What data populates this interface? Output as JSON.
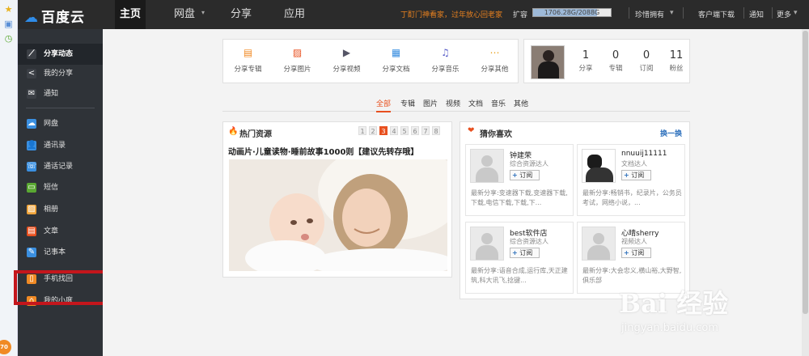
{
  "app": {
    "logo_text": "百度云"
  },
  "top_nav": {
    "tabs": [
      "主页",
      "网盘",
      "分享",
      "应用"
    ],
    "announcement": "丁酊门神看家，过年放心回老家",
    "quota_label": "扩容",
    "quota_text": "1706.28G/2088G",
    "quota_fraction": 0.82,
    "username": "珍惜拥有",
    "links": [
      "客户端下载",
      "通知",
      "更多"
    ]
  },
  "sidebar": {
    "items": [
      {
        "label": "分享动态",
        "icon": "activity-icon",
        "color": "#3b3f45"
      },
      {
        "label": "我的分享",
        "icon": "share-icon",
        "color": "#3b3f45"
      },
      {
        "label": "通知",
        "icon": "mail-icon",
        "color": "#3b3f45"
      },
      {
        "label": "网盘",
        "icon": "cloud-icon",
        "color": "#3a8fe0"
      },
      {
        "label": "通讯录",
        "icon": "contacts-icon",
        "color": "#3a8fe0"
      },
      {
        "label": "通话记录",
        "icon": "call-log-icon",
        "color": "#3a8fe0"
      },
      {
        "label": "短信",
        "icon": "sms-icon",
        "color": "#5aa832"
      },
      {
        "label": "相册",
        "icon": "album-icon",
        "color": "#f0a43a"
      },
      {
        "label": "文章",
        "icon": "article-icon",
        "color": "#e8501f"
      },
      {
        "label": "记事本",
        "icon": "notepad-icon",
        "color": "#3a8fe0"
      },
      {
        "label": "手机找回",
        "icon": "phone-find-icon",
        "color": "#f08a24"
      },
      {
        "label": "我的小度",
        "icon": "home-icon",
        "color": "#f08a24"
      }
    ]
  },
  "share_panel": {
    "buttons": [
      "分享专辑",
      "分享图片",
      "分享视频",
      "分享文档",
      "分享音乐",
      "分享其他"
    ]
  },
  "profile": {
    "stats": [
      {
        "num": "1",
        "label": "分享"
      },
      {
        "num": "0",
        "label": "专辑"
      },
      {
        "num": "0",
        "label": "订阅"
      },
      {
        "num": "11",
        "label": "粉丝"
      }
    ]
  },
  "filter_tabs": [
    "全部",
    "专辑",
    "图片",
    "视频",
    "文档",
    "音乐",
    "其他"
  ],
  "hot": {
    "title": "热门资源",
    "pages": [
      "1",
      "2",
      "3",
      "4",
      "5",
      "6",
      "7",
      "8"
    ],
    "current_page": "3",
    "headline": "动画片·儿童读物·睡前故事1000则【建议先转存哦】"
  },
  "guess": {
    "title": "猜你喜欢",
    "refresh": "换一换",
    "subscribe_label": "订阅",
    "cards": [
      {
        "name": "钟建荣",
        "role": "综合资源达人",
        "desc": "最新分享:变速器下载,变速器下载,下载,电信下载,下载,下..."
      },
      {
        "name": "nnuuij11111",
        "role": "文档达人",
        "desc": "最新分享:畅销书，纪录片，公务员考试，网络小说，..."
      },
      {
        "name": "best软件店",
        "role": "综合资源达人",
        "desc": "最新分享:语音合成,运行库,天正建筑,科大讯飞,捻键..."
      },
      {
        "name": "心晴sherry",
        "role": "视频达人",
        "desc": "最新分享:大会忠义,横山裕,大野智,俱乐部"
      }
    ]
  },
  "watermark": {
    "main": "Bai 经验",
    "sub": "jingyan.baidu.com"
  },
  "strip_badge": "70"
}
